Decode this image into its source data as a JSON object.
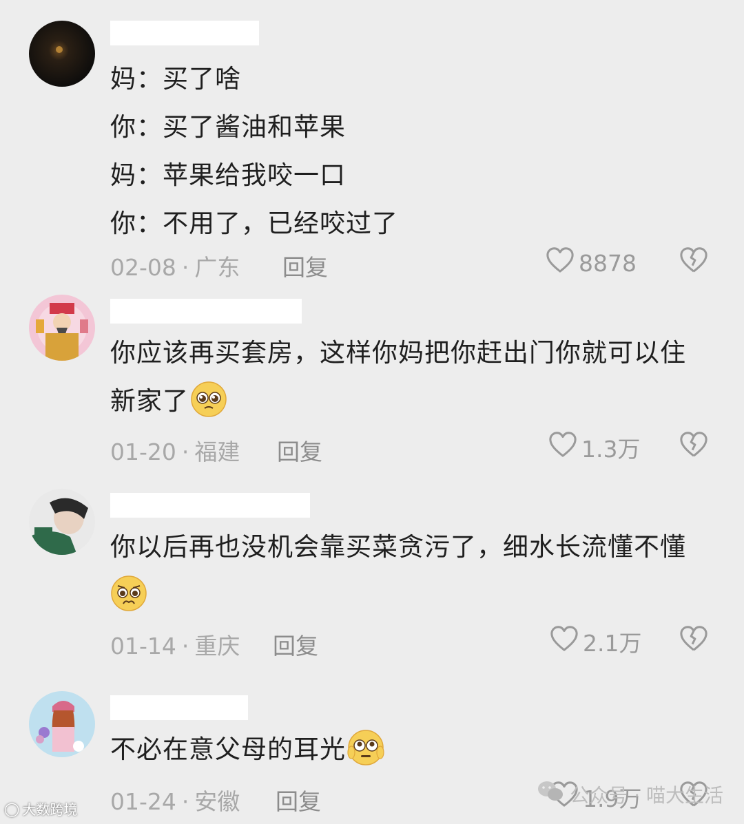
{
  "comments": [
    {
      "lines": [
        "妈：买了啥",
        "你：买了酱油和苹果",
        "妈：苹果给我咬一口",
        "你：不用了，已经咬过了"
      ],
      "date": "02-08",
      "region": "广东",
      "reply": "回复",
      "likes": "8878"
    },
    {
      "lines": [
        "你应该再买套房，这样你妈把你赶出门你就可以住",
        "新家了"
      ],
      "date": "01-20",
      "region": "福建",
      "reply": "回复",
      "likes": "1.3万"
    },
    {
      "lines": [
        "你以后再也没机会靠买菜贪污了，细水长流懂不懂"
      ],
      "date": "01-14",
      "region": "重庆",
      "reply": "回复",
      "likes": "2.1万"
    },
    {
      "lines": [
        "不必在意父母的耳光"
      ],
      "date": "01-24",
      "region": "安徽",
      "reply": "回复",
      "likes": "1.9万"
    }
  ],
  "separator": "·",
  "watermark_left": "大数跨境",
  "watermark_right": "公众号 · 喵大生活",
  "icons": [
    "heart-outline-icon",
    "broken-heart-icon",
    "pleading-face-emoji",
    "worried-face-emoji",
    "flushed-face-emoji",
    "wechat-icon"
  ],
  "colors": {
    "background": "#ededed",
    "text": "#1f1f1f",
    "meta": "#a8a8a8",
    "redaction": "#ffffff"
  }
}
